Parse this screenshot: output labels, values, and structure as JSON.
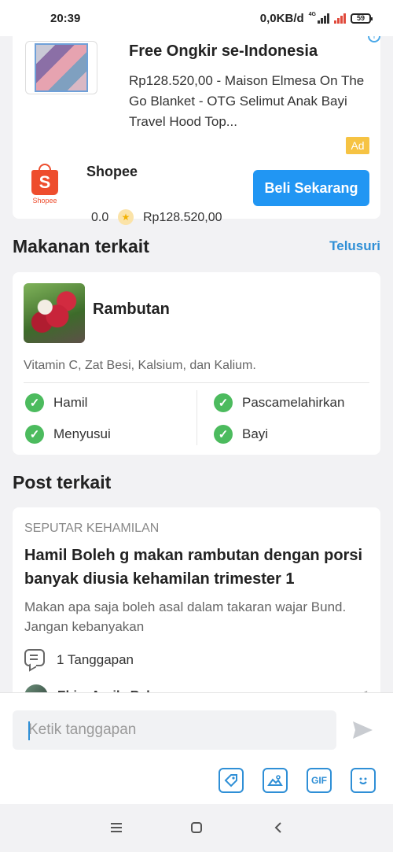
{
  "status_bar": {
    "time": "20:39",
    "network_speed": "0,0KB/d",
    "network_type": "4G",
    "battery": "59"
  },
  "ad": {
    "title": "Free Ongkir se-Indonesia",
    "description": "Rp128.520,00 - Maison Elmesa On The Go Blanket - OTG Selimut Anak Bayi Travel Hood Top...",
    "badge": "Ad",
    "shop_logo_text": "S",
    "shop_logo_label": "Shopee",
    "shop_name": "Shopee",
    "rating": "0.0",
    "price": "Rp128.520,00",
    "buy_label": "Beli Sekarang",
    "info_icon": "info-icon"
  },
  "related_food": {
    "section_title": "Makanan terkait",
    "browse_link": "Telusuri",
    "name": "Rambutan",
    "nutrients": "Vitamin C, Zat Besi, Kalsium, dan Kalium.",
    "safe_for": [
      {
        "label": "Hamil",
        "icon": "check-circle-icon"
      },
      {
        "label": "Pascamelahirkan",
        "icon": "check-circle-icon"
      },
      {
        "label": "Menyusui",
        "icon": "check-circle-icon"
      },
      {
        "label": "Bayi",
        "icon": "check-circle-icon"
      }
    ]
  },
  "related_post": {
    "section_title": "Post terkait",
    "category": "SEPUTAR KEHAMILAN",
    "title": "Hamil Boleh g makan rambutan dengan porsi banyak diusia kehamilan trimester 1",
    "body": "Makan apa saja boleh asal dalam takaran wajar Bund. Jangan kebanyakan",
    "comment_count": "1 Tanggapan",
    "author": "Ebim Aprila Rahman"
  },
  "reply": {
    "placeholder": "Ketik tanggapan",
    "tools": [
      "tag-icon",
      "image-icon",
      "gif-icon",
      "sticker-icon"
    ],
    "gif_label": "GIF"
  },
  "colors": {
    "accent": "#2f8fd6",
    "button": "#2196f3",
    "shopee": "#ee4d2d",
    "check": "#4cbb5e",
    "ad_badge": "#f6c343"
  }
}
